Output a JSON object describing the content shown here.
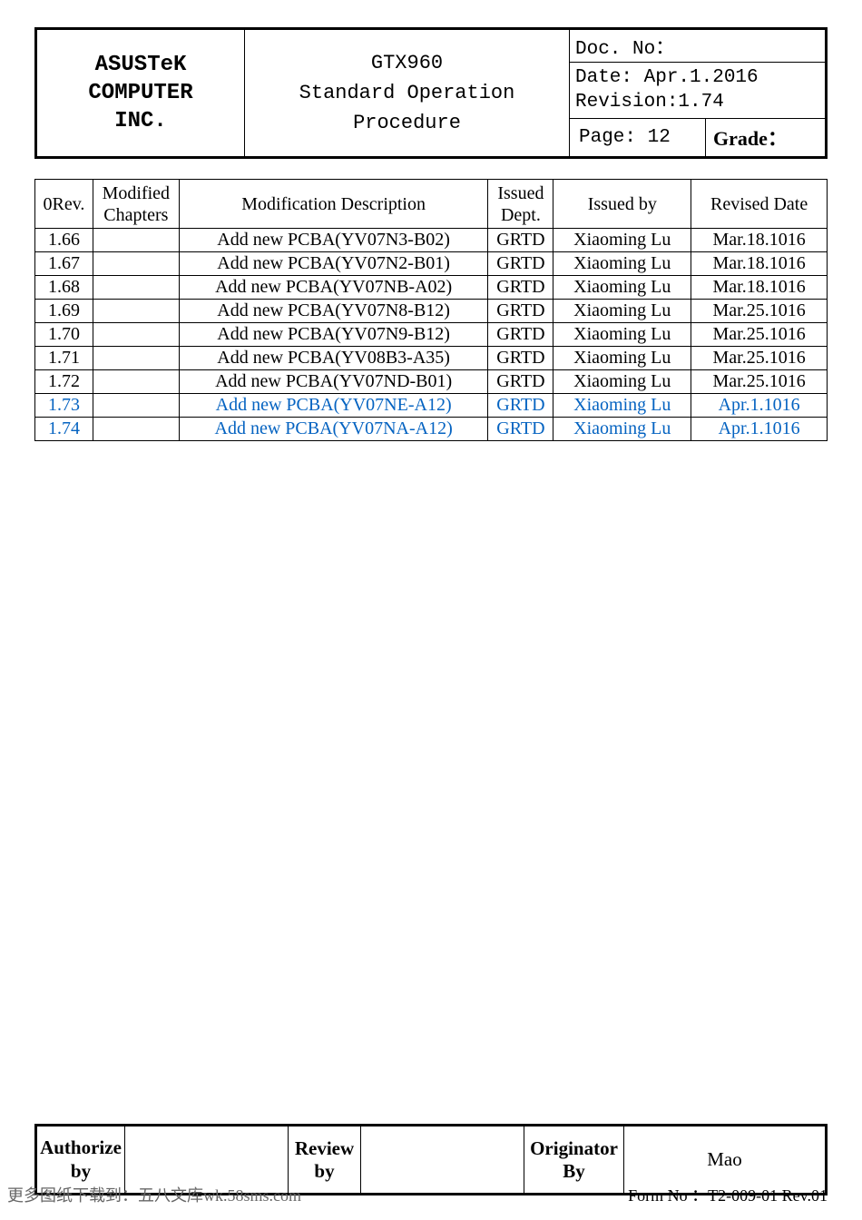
{
  "header": {
    "company_line1": "ASUSTeK COMPUTER",
    "company_line2": "INC.",
    "title_line1": "GTX960",
    "title_line2": "Standard Operation Procedure",
    "doc_no_label": "Doc. No：",
    "date_label": "Date: Apr.1.2016",
    "revision_label": "Revision:1.74",
    "page_label": "Page: 12",
    "grade_label": "Grade："
  },
  "rev_headers": {
    "rev": "0Rev.",
    "modified": "Modified Chapters",
    "desc": "Modification Description",
    "dept": "Issued Dept.",
    "by": "Issued by",
    "date": "Revised Date"
  },
  "rows": [
    {
      "rev": "1.66",
      "mod": "",
      "desc": "Add new PCBA(YV07N3-B02)",
      "dept": "GRTD",
      "by": "Xiaoming Lu",
      "date": "Mar.18.1016",
      "link": false
    },
    {
      "rev": "1.67",
      "mod": "",
      "desc": "Add new PCBA(YV07N2-B01)",
      "dept": "GRTD",
      "by": "Xiaoming Lu",
      "date": "Mar.18.1016",
      "link": false
    },
    {
      "rev": "1.68",
      "mod": "",
      "desc": "Add new PCBA(YV07NB-A02)",
      "dept": "GRTD",
      "by": "Xiaoming Lu",
      "date": "Mar.18.1016",
      "link": false
    },
    {
      "rev": "1.69",
      "mod": "",
      "desc": "Add new PCBA(YV07N8-B12)",
      "dept": "GRTD",
      "by": "Xiaoming Lu",
      "date": "Mar.25.1016",
      "link": false
    },
    {
      "rev": "1.70",
      "mod": "",
      "desc": "Add new PCBA(YV07N9-B12)",
      "dept": "GRTD",
      "by": "Xiaoming Lu",
      "date": "Mar.25.1016",
      "link": false
    },
    {
      "rev": "1.71",
      "mod": "",
      "desc": "Add new PCBA(YV08B3-A35)",
      "dept": "GRTD",
      "by": "Xiaoming Lu",
      "date": "Mar.25.1016",
      "link": false
    },
    {
      "rev": "1.72",
      "mod": "",
      "desc": "Add new PCBA(YV07ND-B01)",
      "dept": "GRTD",
      "by": "Xiaoming Lu",
      "date": "Mar.25.1016",
      "link": false
    },
    {
      "rev": "1.73",
      "mod": "",
      "desc": "Add new PCBA(YV07NE-A12)",
      "dept": "GRTD",
      "by": "Xiaoming Lu",
      "date": "Apr.1.1016",
      "link": true
    },
    {
      "rev": "1.74",
      "mod": "",
      "desc": "Add new PCBA(YV07NA-A12)",
      "dept": "GRTD",
      "by": "Xiaoming Lu",
      "date": "Apr.1.1016",
      "link": true
    }
  ],
  "footer": {
    "authorize_label": "Authorize by",
    "authorize_val": "",
    "review_label": "Review by",
    "review_val": "",
    "originator_label": "Originator By",
    "originator_val": "Mao"
  },
  "bottom": {
    "left": "更多图纸下载到：五八文库wk.58sms.com",
    "right": "Form No ：T2-009-01 Rev.01"
  }
}
